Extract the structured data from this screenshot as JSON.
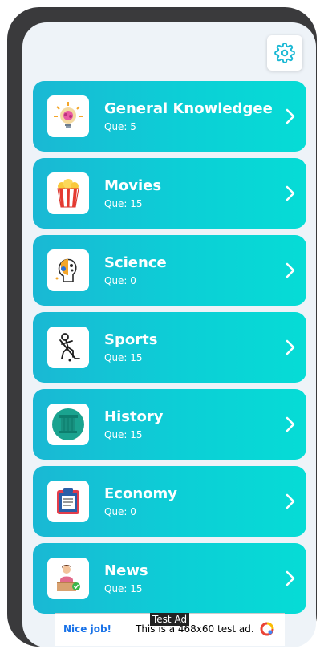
{
  "settings": {
    "icon": "gear-icon",
    "color": "#1ab8d4"
  },
  "categories": [
    {
      "title": "General Knowledgee",
      "count": "Que: 5",
      "icon": "brain-bulb-icon"
    },
    {
      "title": "Movies",
      "count": "Que: 15",
      "icon": "popcorn-icon"
    },
    {
      "title": "Science",
      "count": "Que: 0",
      "icon": "science-head-icon"
    },
    {
      "title": "Sports",
      "count": "Que: 15",
      "icon": "hockey-player-icon"
    },
    {
      "title": "History",
      "count": "Que: 15",
      "icon": "column-icon"
    },
    {
      "title": "Economy",
      "count": "Que: 0",
      "icon": "clipboard-icon"
    },
    {
      "title": "News",
      "count": "Que: 15",
      "icon": "news-presenter-icon"
    }
  ],
  "ad": {
    "label": "Test Ad",
    "nice": "Nice job!",
    "text": "This is a 468x60 test ad."
  },
  "colors": {
    "card_start": "#1ab8d4",
    "card_end": "#06dcd6",
    "background": "#eef3f8"
  }
}
